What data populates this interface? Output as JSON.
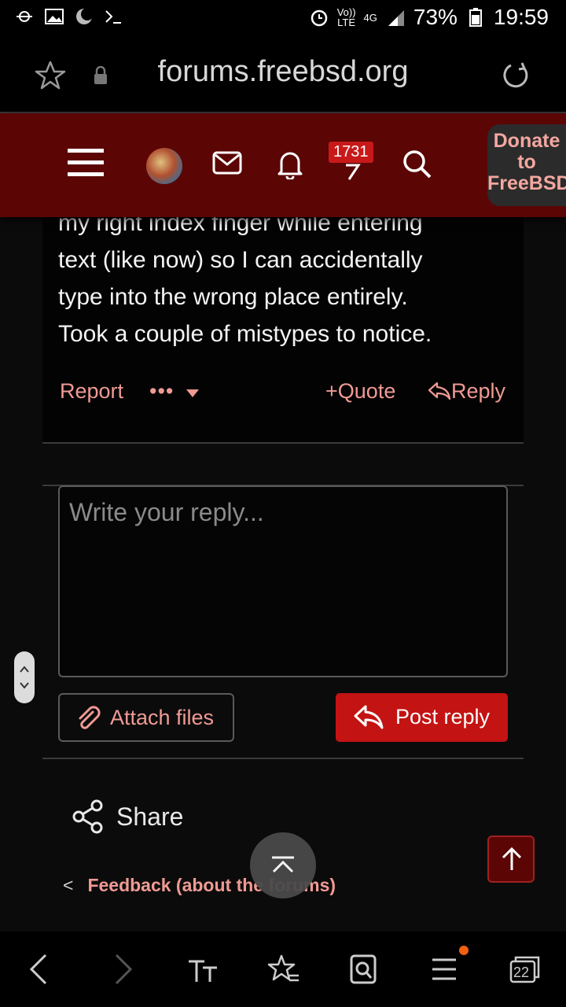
{
  "status_bar": {
    "network_label_top": "Vo))",
    "network_label_bottom": "LTE",
    "signal_label": "4G",
    "battery": "73%",
    "time": "19:59",
    "left_icons": [
      "wifi-off-icon",
      "image-icon",
      "moon-icon",
      "terminal-icon"
    ]
  },
  "browser": {
    "url": "forums.freebsd.org"
  },
  "forum_header": {
    "notification_count": "1731",
    "donate_line1": "Donate",
    "donate_line2": "to",
    "donate_line3": "FreeBSD"
  },
  "post": {
    "partial_line": "my right index finger while entering",
    "text_lines": [
      "text (like now) so I can accidentally",
      "type into the wrong place entirely.",
      "Took a couple of mistypes to notice."
    ],
    "actions": {
      "report": "Report",
      "more": "•••",
      "quote": "Quote",
      "reply": "Reply"
    }
  },
  "reply_form": {
    "placeholder": "Write your reply...",
    "attach_label": "Attach files",
    "post_label": "Post reply"
  },
  "footer": {
    "share_label": "Share",
    "feedback_link": "Feedback (about the forums)"
  },
  "bottom_nav": {
    "tab_count": "22"
  },
  "colors": {
    "header_bg": "#5b0505",
    "accent_red": "#c31313",
    "link_pink": "#f09a94"
  }
}
